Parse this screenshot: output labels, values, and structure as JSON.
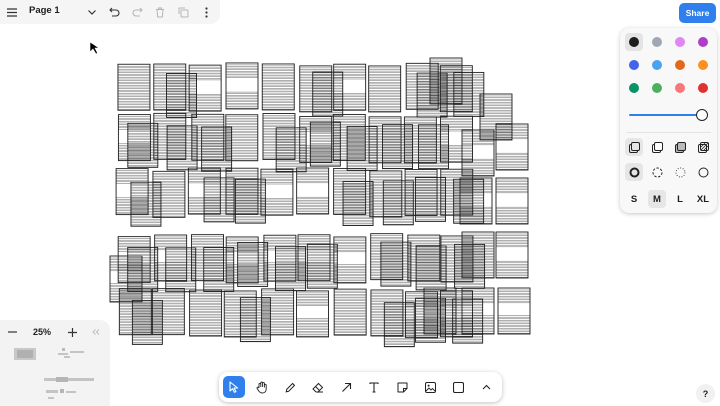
{
  "menu": {
    "page_name": "Page 1"
  },
  "share": {
    "label": "Share"
  },
  "style_panel": {
    "colors": [
      "#1d1d1d",
      "#9fa8b2",
      "#e085f4",
      "#ae3ec9",
      "#4465e9",
      "#4ba1f1",
      "#e16919",
      "#ff8f1f",
      "#099268",
      "#4cb05e",
      "#f87777",
      "#e03131"
    ],
    "selected_color": "#1d1d1d",
    "accent": "#2f80ed",
    "opacity": 1.0,
    "sizes": [
      "S",
      "M",
      "L",
      "XL"
    ],
    "selected_size": "M"
  },
  "zoom": {
    "level": "25%"
  },
  "toolbar": {
    "tools": [
      "select-icon",
      "hand-icon",
      "draw-icon",
      "eraser-icon",
      "arrow-icon",
      "text-icon",
      "note-icon",
      "image-icon",
      "rectangle-icon",
      "more-tools-icon"
    ],
    "active_tool": "select-icon"
  },
  "help": {
    "label": "?"
  }
}
